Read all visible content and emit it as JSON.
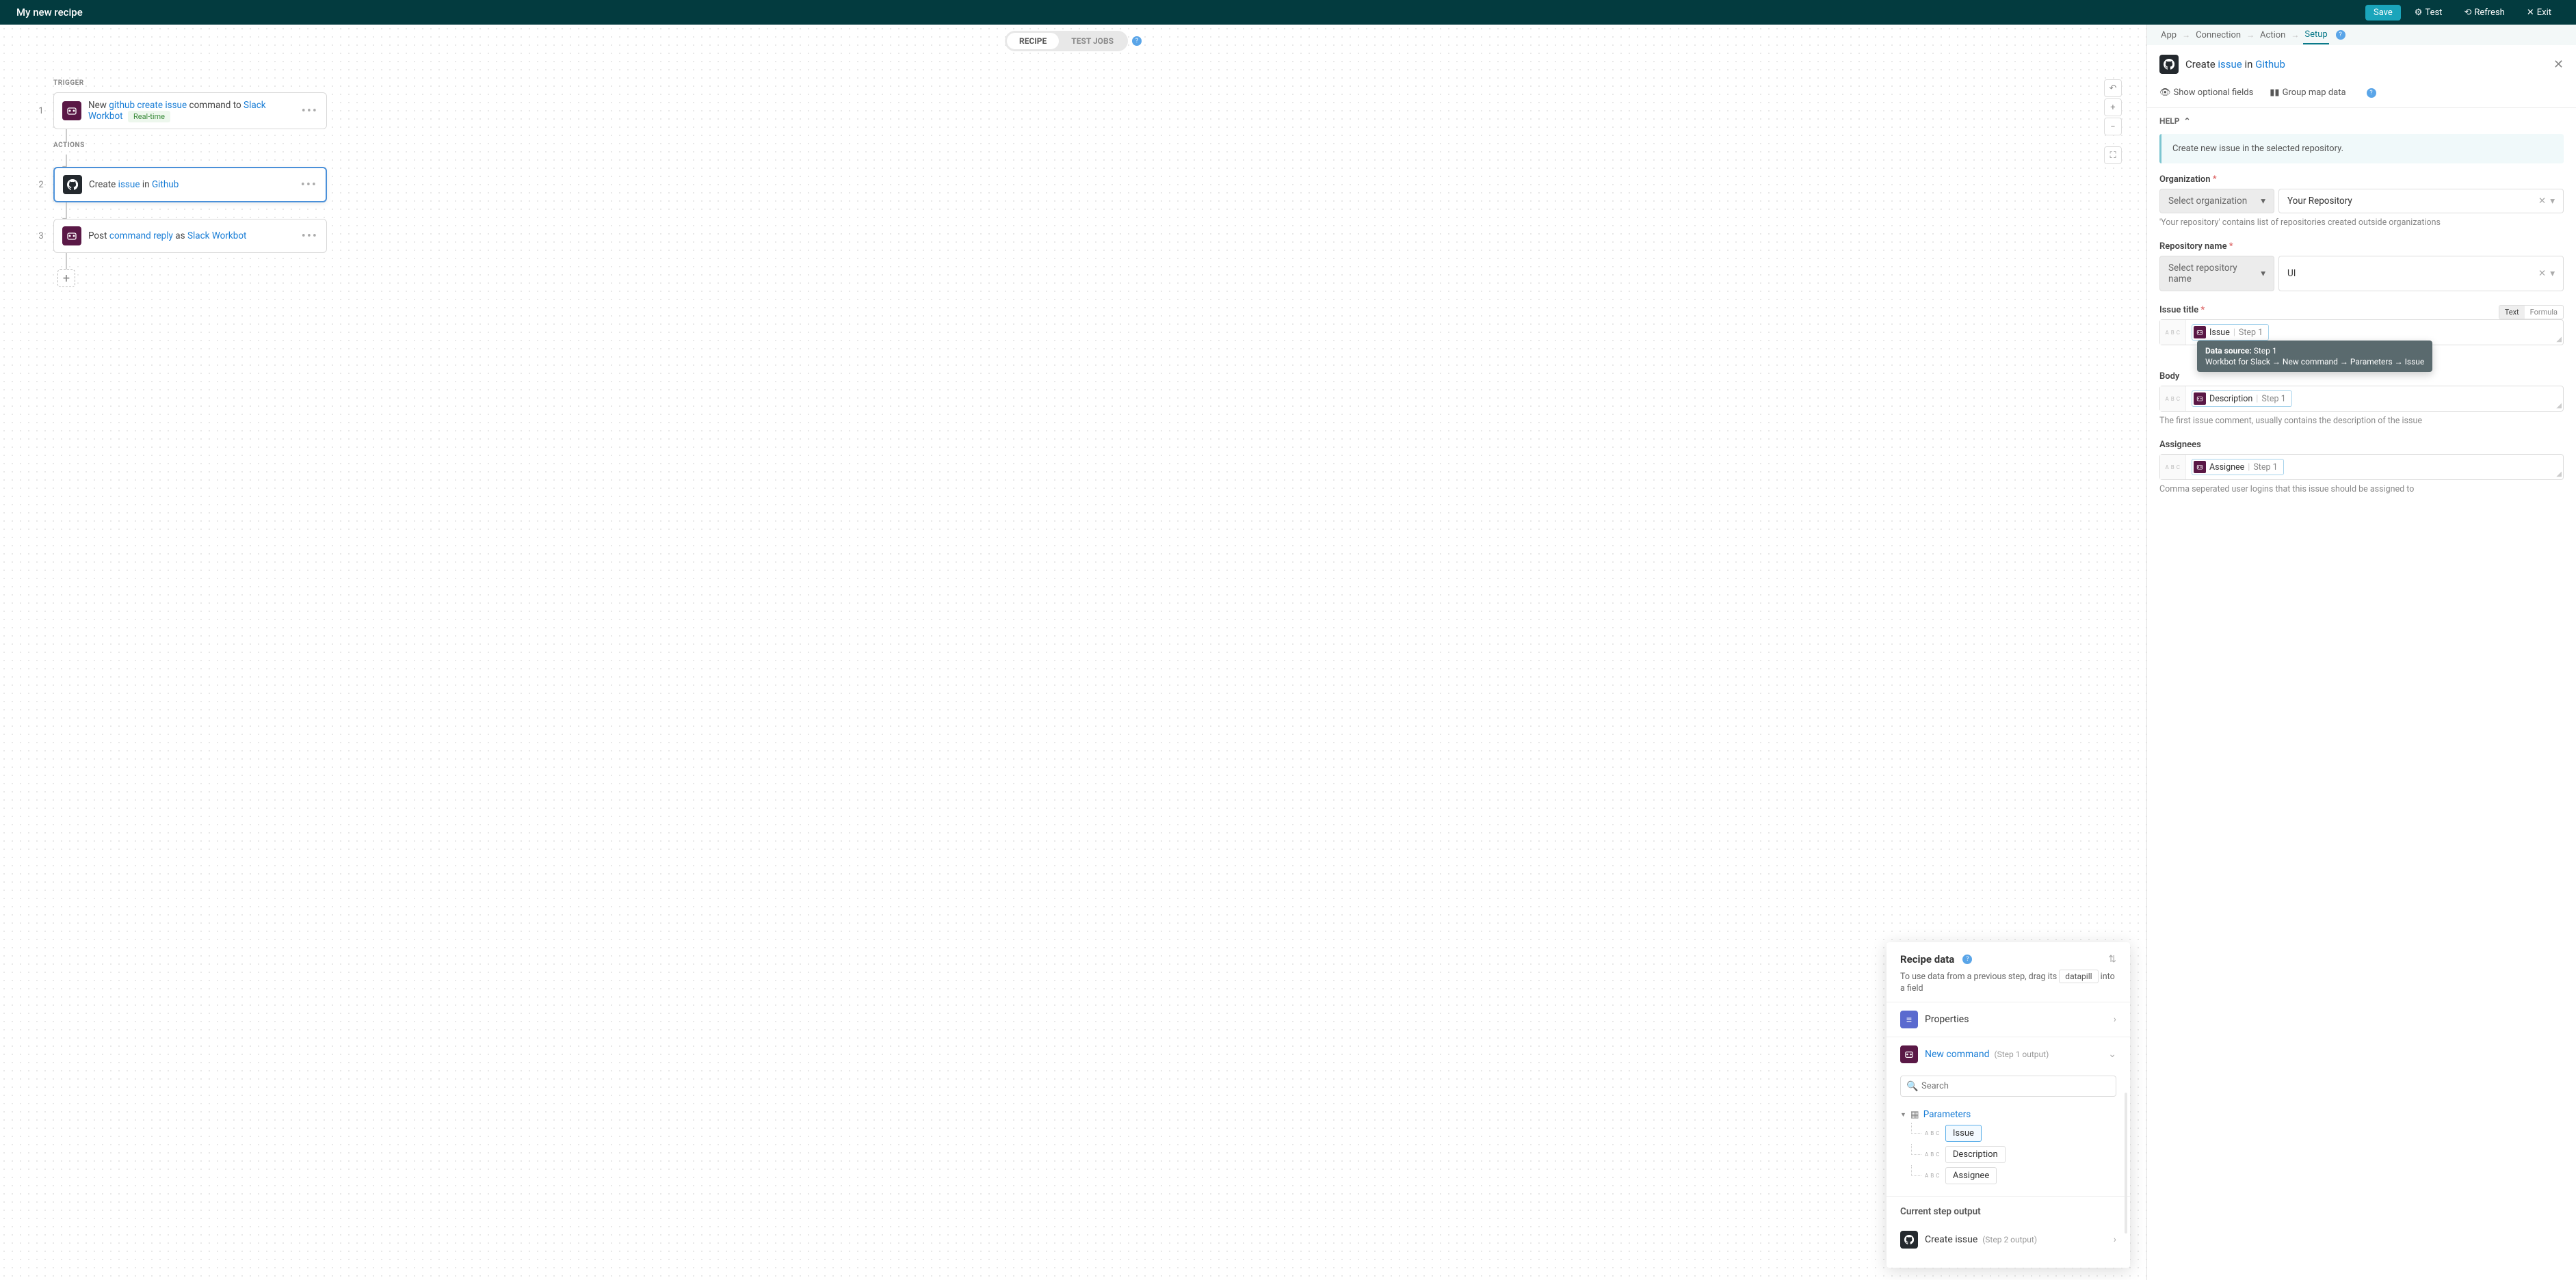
{
  "header": {
    "title": "My new recipe",
    "save": "Save",
    "test": "Test",
    "refresh": "Refresh",
    "exit": "Exit"
  },
  "tabs": {
    "recipe": "RECIPE",
    "test_jobs": "TEST JOBS"
  },
  "flow": {
    "trigger_label": "TRIGGER",
    "actions_label": "ACTIONS",
    "step1": {
      "pre": "New ",
      "cmd": "github create issue",
      "mid": " command to ",
      "app": "Slack Workbot",
      "badge": "Real-time"
    },
    "step2": {
      "pre": "Create ",
      "obj": "issue",
      "mid": " in ",
      "app": "Github"
    },
    "step3": {
      "pre": "Post ",
      "obj": "command reply",
      "mid": " as ",
      "app": "Slack Workbot"
    }
  },
  "recipe_data": {
    "title": "Recipe data",
    "hint_pre": "To use data from a previous step, drag its ",
    "hint_pill": "datapill",
    "hint_post": " into a field",
    "properties": "Properties",
    "new_command": "New command",
    "new_command_step": "(Step 1 output)",
    "search_placeholder": "Search",
    "parameters": "Parameters",
    "items": {
      "issue": "Issue",
      "description": "Description",
      "assignee": "Assignee"
    },
    "current_step": "Current step output",
    "create_issue": "Create issue",
    "create_issue_step": "(Step 2 output)"
  },
  "side": {
    "tabs": {
      "app": "App",
      "connection": "Connection",
      "action": "Action",
      "setup": "Setup"
    },
    "title": {
      "pre": "Create ",
      "obj": "issue",
      "mid": " in ",
      "app": "Github"
    },
    "opt_fields": "Show optional fields",
    "group_map": "Group map data",
    "help_label": "HELP",
    "help_text": "Create new issue in the selected repository.",
    "org": {
      "label": "Organization",
      "select": "Select organization",
      "value": "Your Repository",
      "hint": "'Your repository' contains list of repositories created outside organizations"
    },
    "repo": {
      "label": "Repository name",
      "select": "Select repository name",
      "value": "UI"
    },
    "issue_title": {
      "label": "Issue title",
      "text_mode": "Text",
      "formula_mode": "Formula",
      "pill_name": "Issue",
      "pill_step": "Step 1"
    },
    "tooltip": {
      "line1_label": "Data source: ",
      "line1_val": "Step 1",
      "line2": "Workbot for Slack → New command → Parameters → Issue"
    },
    "body": {
      "label": "Body",
      "pill_name": "Description",
      "pill_step": "Step 1",
      "hint": "The first issue comment, usually contains the description of the issue"
    },
    "assignees": {
      "label": "Assignees",
      "pill_name": "Assignee",
      "pill_step": "Step 1",
      "hint": "Comma seperated user logins that this issue should be assigned to"
    }
  }
}
